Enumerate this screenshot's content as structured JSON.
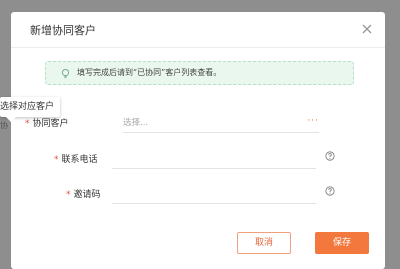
{
  "dialog": {
    "title": "新增协同客户",
    "close_icon": "close-icon"
  },
  "notice": {
    "icon": "lightbulb-icon",
    "text": "填写完成后请到“已协同”客户列表查看。"
  },
  "form": {
    "customer": {
      "required_mark": "*",
      "label": "协同客户",
      "placeholder": "选择...",
      "more_icon": "more-dots-icon",
      "more_text": "···"
    },
    "phone": {
      "required_mark": "*",
      "label": "联系电话",
      "value": "",
      "help_icon": "question-circle-icon"
    },
    "invite": {
      "required_mark": "*",
      "label": "邀请码",
      "value": "",
      "help_icon": "question-circle-icon"
    }
  },
  "buttons": {
    "cancel": "取消",
    "save": "保存"
  },
  "tooltip": {
    "text": "选择对应客户",
    "behind_text": "协"
  },
  "colors": {
    "accent": "#f2783e",
    "notice_bg": "#eaf7ef",
    "overlay": "#8e8e8e"
  }
}
